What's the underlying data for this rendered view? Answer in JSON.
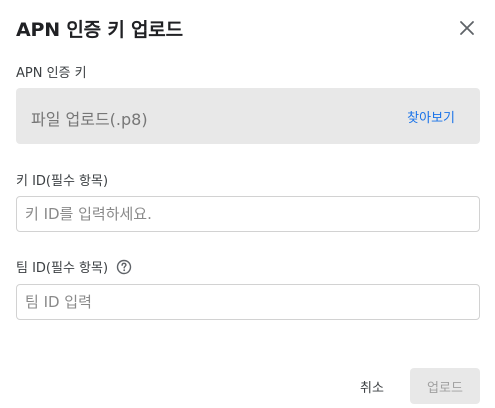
{
  "dialog": {
    "title": "APN 인증 키 업로드"
  },
  "apn_key": {
    "label": "APN 인증 키",
    "upload_placeholder": "파일 업로드(.p8)",
    "browse_label": "찾아보기"
  },
  "key_id": {
    "label": "키 ID(필수 항목)",
    "placeholder": "키 ID를 입력하세요.",
    "value": ""
  },
  "team_id": {
    "label": "팀 ID(필수 항목)",
    "placeholder": "팀 ID 입력",
    "value": ""
  },
  "footer": {
    "cancel_label": "취소",
    "upload_label": "업로드"
  },
  "icons": {
    "close": "close-icon",
    "help": "help-circle-icon"
  },
  "colors": {
    "link": "#1a73e8",
    "disabled_bg": "#e8e8e8",
    "disabled_text": "#a0a0a0"
  }
}
